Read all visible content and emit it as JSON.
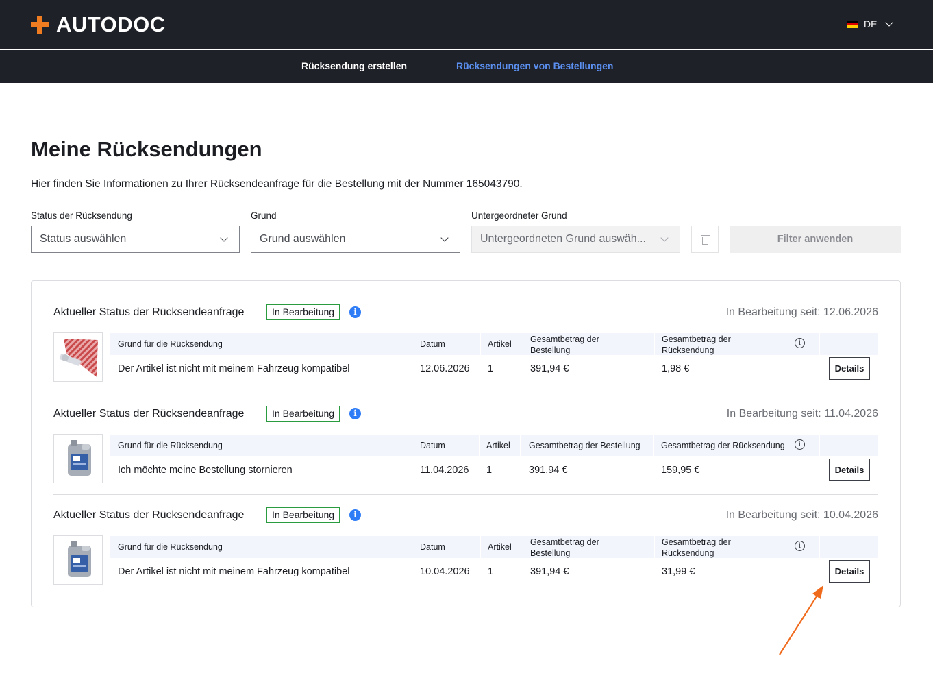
{
  "header": {
    "logo_text": "AUTODOC",
    "language": "DE"
  },
  "nav": {
    "create_return": "Rücksendung erstellen",
    "order_returns": "Rücksendungen von Bestellungen"
  },
  "page": {
    "title": "Meine Rücksendungen",
    "subtitle": "Hier finden Sie Informationen zu Ihrer Rücksendeanfrage für die Bestellung mit der Nummer 165043790."
  },
  "filters": {
    "status_label": "Status der Rücksendung",
    "status_placeholder": "Status auswählen",
    "reason_label": "Grund",
    "reason_placeholder": "Grund auswählen",
    "subreason_label": "Untergeordneter Grund",
    "subreason_placeholder": "Untergeordneten Grund auswäh...",
    "apply_label": "Filter anwenden"
  },
  "table_headers": {
    "reason": "Grund für die Rücksendung",
    "date": "Datum",
    "items": "Artikel",
    "order_total": "Gesamtbetrag der Bestellung",
    "return_total": "Gesamtbetrag der Rücksendung"
  },
  "returns": [
    {
      "status_title": "Aktueller Status der Rücksendeanfrage",
      "status": "In Bearbeitung",
      "since": "In Bearbeitung seit: 12.06.2026",
      "reason": "Der Artikel ist nicht mit meinem Fahrzeug kompatibel",
      "date": "12.06.2026",
      "items": "1",
      "order_total": "391,94 €",
      "return_total": "1,98 €",
      "details_label": "Details",
      "thumb_icon": "filter-product-image"
    },
    {
      "status_title": "Aktueller Status der Rücksendeanfrage",
      "status": "In Bearbeitung",
      "since": "In Bearbeitung seit: 11.04.2026",
      "reason": "Ich möchte meine Bestellung stornieren",
      "date": "11.04.2026",
      "items": "1",
      "order_total": "391,94 €",
      "return_total": "159,95 €",
      "details_label": "Details",
      "thumb_icon": "oil-canister-image"
    },
    {
      "status_title": "Aktueller Status der Rücksendeanfrage",
      "status": "In Bearbeitung",
      "since": "In Bearbeitung seit: 10.04.2026",
      "reason": "Der Artikel ist nicht mit meinem Fahrzeug kompatibel",
      "date": "10.04.2026",
      "items": "1",
      "order_total": "391,94 €",
      "return_total": "31,99 €",
      "details_label": "Details",
      "thumb_icon": "oil-canister-image"
    }
  ],
  "colors": {
    "header_bg": "#1e2128",
    "brand_orange": "#ef7c21",
    "active_nav": "#5b8ff0",
    "badge_border": "#2a9b3e",
    "info_blue": "#2e7cf6",
    "annotation_arrow": "#f06a1c"
  }
}
